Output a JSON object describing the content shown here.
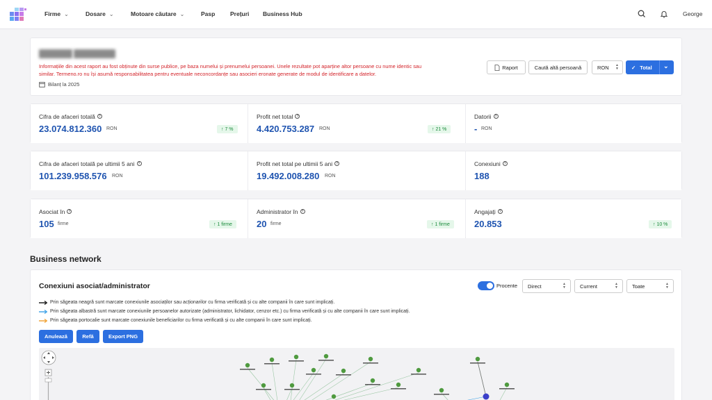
{
  "nav": {
    "items": [
      {
        "label": "Firme",
        "dropdown": true
      },
      {
        "label": "Dosare",
        "dropdown": true
      },
      {
        "label": "Motoare căutare",
        "dropdown": true
      },
      {
        "label": "Pasp",
        "dropdown": false
      },
      {
        "label": "Prețuri",
        "dropdown": false
      },
      {
        "label": "Business Hub",
        "dropdown": false
      }
    ],
    "user": "George"
  },
  "header": {
    "disclaimer": "Informațiile din acest raport au fost obținute din surse publice, pe baza numelui și prenumelui persoanei. Unele rezultate pot aparține altor persoane cu nume identic sau similar. Termeno.ro nu își asumă responsabilitatea pentru eventuale neconcordanțe sau asocieri eronate generate de modul de identificare a datelor.",
    "bilant": "Bilanț la 2025",
    "buttons": {
      "raport": "Raport",
      "cauta": "Caută altă persoană",
      "currency": "RON",
      "total": "Total"
    }
  },
  "stats": {
    "cifra": {
      "label": "Cifra de afaceri totală",
      "value": "23.074.812.360",
      "unit": "RON",
      "badge": "↑ 7 %"
    },
    "profit": {
      "label": "Profit net total",
      "value": "4.420.753.287",
      "unit": "RON",
      "badge": "↑ 21 %"
    },
    "datorii": {
      "label": "Datorii",
      "value": "-",
      "unit": "RON"
    },
    "cifra5": {
      "label": "Cifra de afaceri totală pe ultimii 5 ani",
      "value": "101.239.958.576",
      "unit": "RON"
    },
    "profit5": {
      "label": "Profit net total pe ultimii 5 ani",
      "value": "19.492.008.280",
      "unit": "RON"
    },
    "conexiuni": {
      "label": "Conexiuni",
      "value": "188"
    },
    "asociat": {
      "label": "Asociat în",
      "value": "105",
      "unit": "firme",
      "badge": "↑ 1 firme"
    },
    "admin": {
      "label": "Administrator în",
      "value": "20",
      "unit": "firme",
      "badge": "↑ 1 firme"
    },
    "angajati": {
      "label": "Angajați",
      "value": "20.853",
      "badge": "↑ 10 %"
    }
  },
  "network": {
    "section_title": "Business network",
    "title": "Conexiuni asociat/administrator",
    "toggle_label": "Procente",
    "selects": [
      "Direct",
      "Current",
      "Toate"
    ],
    "legend": [
      {
        "text": "Prin săgeata neagră sunt marcate conexiunile asociaților sau acționarilor cu firma verificată și cu alte companii în care sunt implicați.",
        "color": "#111111"
      },
      {
        "text": "Prin săgeata albastră sunt marcate conexiunile persoanelor autorizate (administrator, lichidator, cenzor etc.) cu firma verificată și cu alte companii în care sunt implicați.",
        "color": "#3aa0e6"
      },
      {
        "text": "Prin săgeata portocalie sunt marcate conexiunile beneficiarilor cu firma verificată și cu alte companii în care sunt implicați.",
        "color": "#f0a030"
      }
    ],
    "buttons": {
      "anuleaza": "Anulează",
      "refa": "Refă",
      "export": "Export PNG"
    }
  },
  "colors": {
    "accent": "#2c6fe0",
    "value_blue": "#1f54b0",
    "warning_red": "#d3232a",
    "badge_green": "#1a8a3a"
  }
}
